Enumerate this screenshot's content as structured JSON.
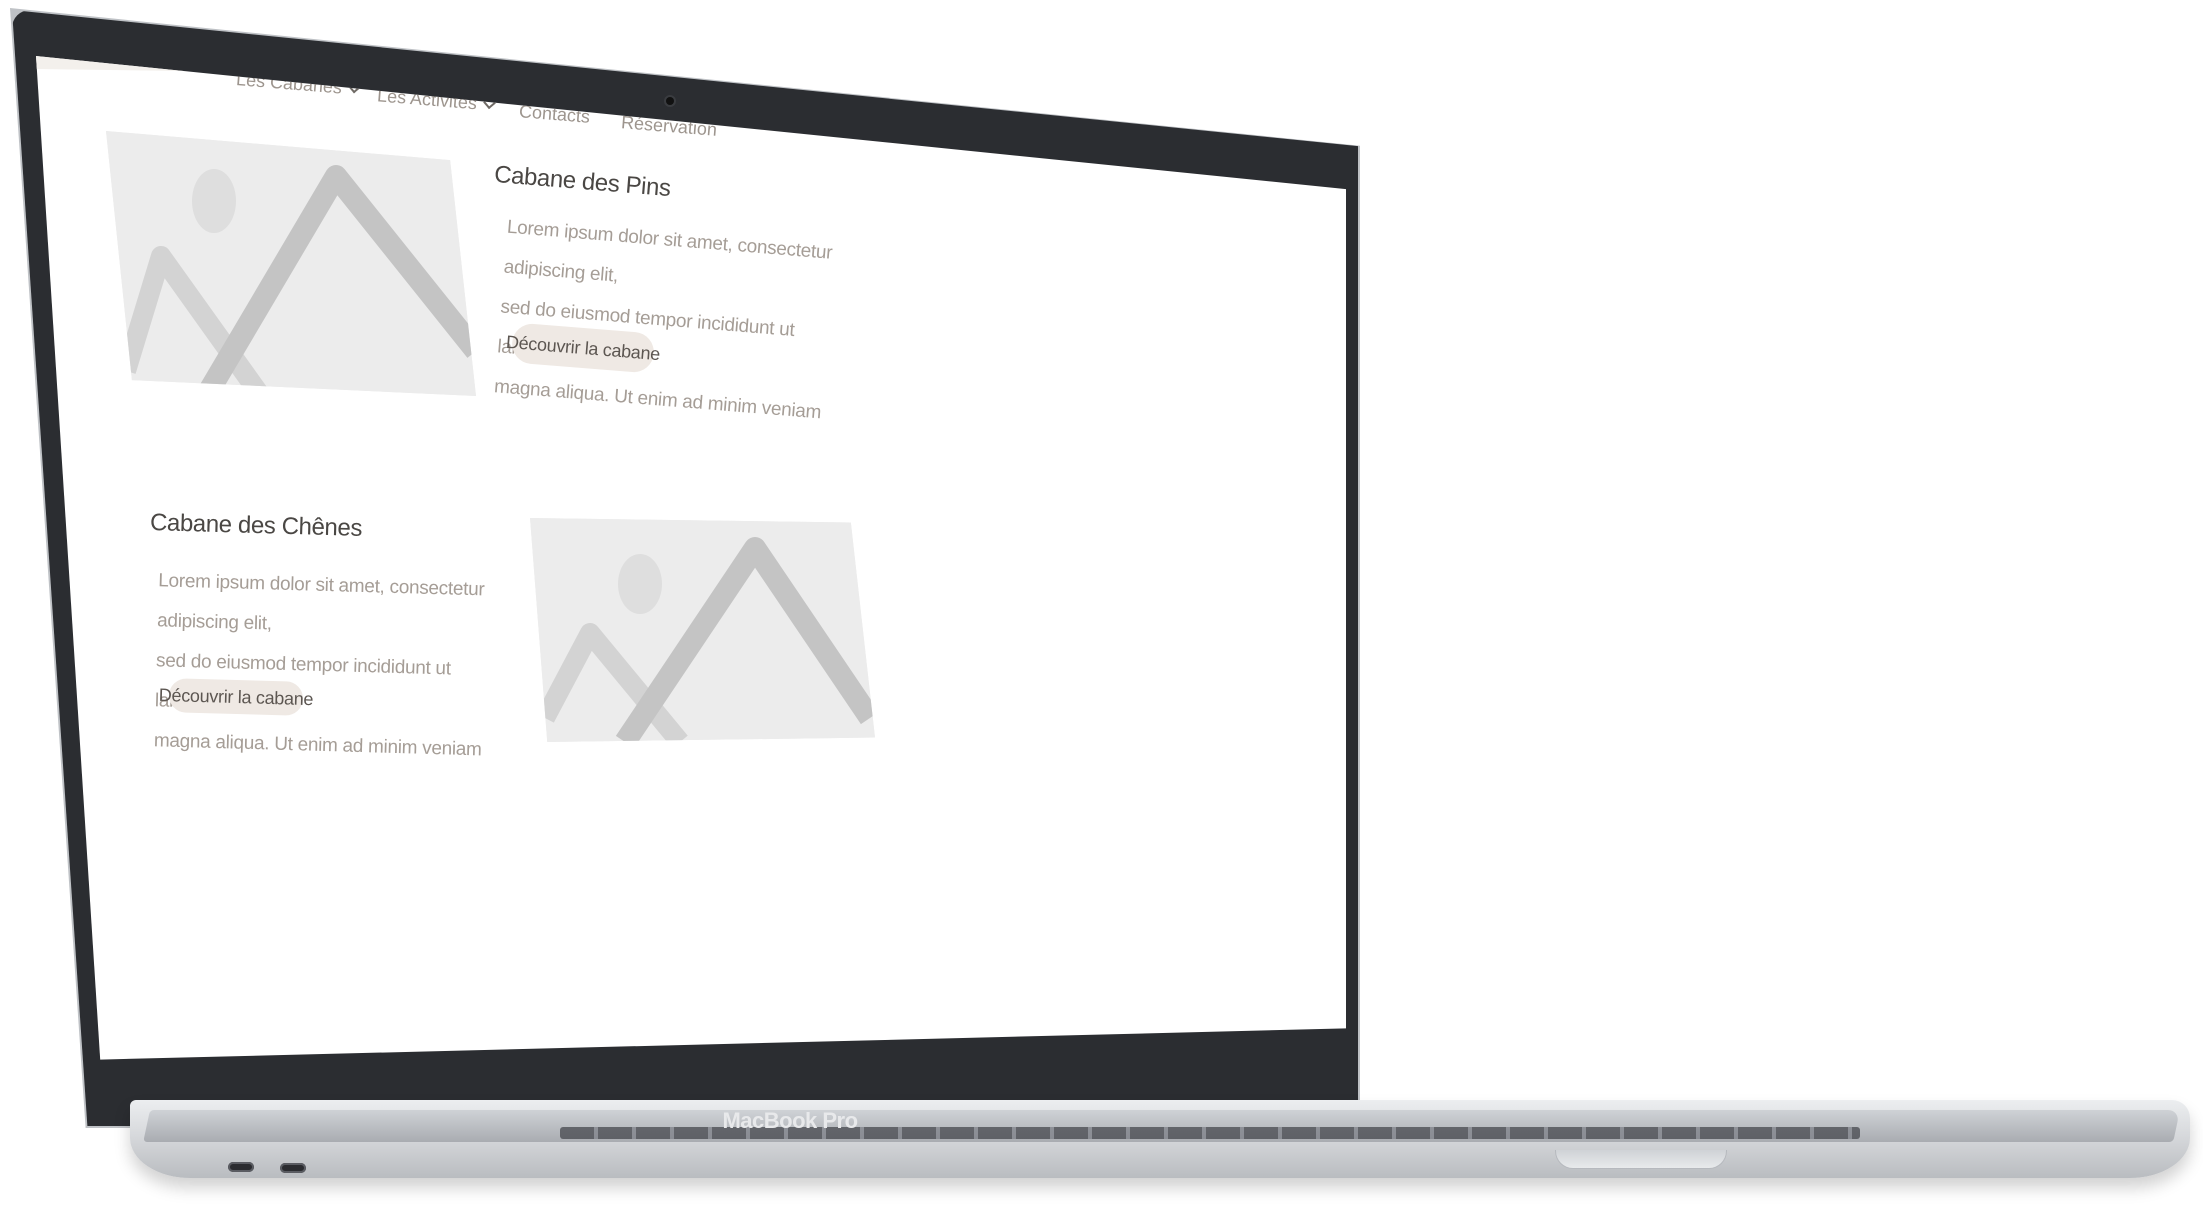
{
  "device": {
    "label": "MacBook Pro"
  },
  "nav": {
    "items": [
      {
        "label": "Les Cabanes",
        "has_dropdown": true
      },
      {
        "label": "Les Activités",
        "has_dropdown": true
      },
      {
        "label": "Contacts",
        "has_dropdown": false
      },
      {
        "label": "Réservation",
        "has_dropdown": false
      }
    ]
  },
  "cabins": [
    {
      "title": "Cabane des Pins",
      "lines": [
        "Lorem ipsum dolor sit amet, consectetur adipiscing elit,",
        "sed do eiusmod tempor incididunt ut labore et dolore",
        "magna aliqua. Ut enim ad minim veniam"
      ],
      "button_label": "Découvrir la cabane",
      "image_icon": "image-placeholder-icon"
    },
    {
      "title": "Cabane des Chênes",
      "lines": [
        "Lorem ipsum dolor sit amet, consectetur adipiscing elit,",
        "sed do eiusmod tempor incididunt ut labore et dolore",
        "magna aliqua. Ut enim ad minim veniam"
      ],
      "button_label": "Découvrir la cabane",
      "image_icon": "image-placeholder-icon"
    }
  ],
  "colors": {
    "nav_background": "#f3f0ec",
    "button_background": "#efe9e4",
    "placeholder_background": "#ededed",
    "laptop_bezel": "#2b2d31"
  }
}
